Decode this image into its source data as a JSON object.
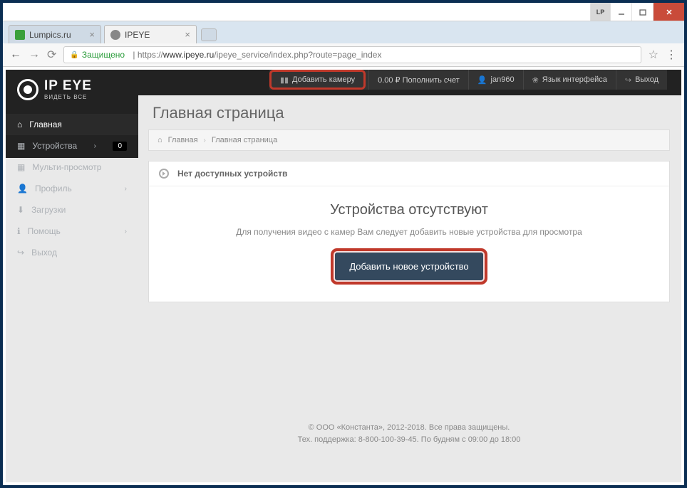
{
  "titlebar": {
    "lp": "LP"
  },
  "tabs": [
    {
      "title": "Lumpics.ru"
    },
    {
      "title": "IPEYE"
    }
  ],
  "address": {
    "secure": "Защищено",
    "protocol": "https://",
    "domain": "www.ipeye.ru",
    "path": "/ipeye_service/index.php?route=page_index"
  },
  "header": {
    "logo": "IP EYE",
    "logo_sub": "ВИДЕТЬ ВСЕ",
    "actions": [
      "Добавить камеру",
      "0.00 ₽ Пополнить счет",
      "jan960",
      "Язык интерфейса",
      "Выход"
    ]
  },
  "sidebar": {
    "items": [
      {
        "label": "Главная"
      },
      {
        "label": "Устройства",
        "badge": "0"
      },
      {
        "label": "Мульти-просмотр"
      },
      {
        "label": "Профиль"
      },
      {
        "label": "Загрузки"
      },
      {
        "label": "Помощь"
      },
      {
        "label": "Выход"
      }
    ]
  },
  "main": {
    "title": "Главная страница",
    "breadcrumb": [
      "Главная",
      "Главная страница"
    ],
    "panel_header": "Нет доступных устройств",
    "empty_title": "Устройства отсутствуют",
    "empty_desc": "Для получения видео с камер Вам следует добавить новые устройства для просмотра",
    "add_button": "Добавить новое устройство"
  },
  "footer": {
    "line1": "© ООО «Константа», 2012-2018. Все права защищены.",
    "line2": "Тех. поддержка: 8-800-100-39-45. По будням с 09:00 до 18:00"
  }
}
